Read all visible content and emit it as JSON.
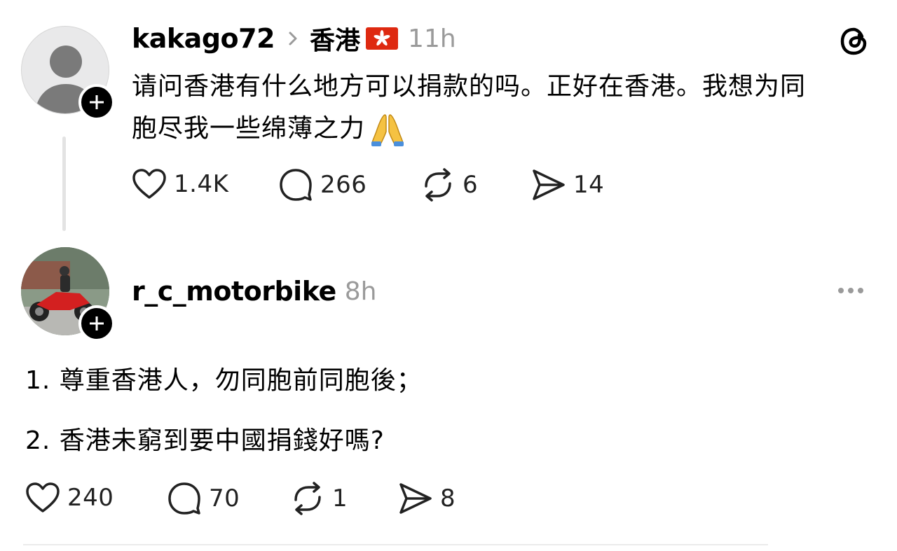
{
  "post": {
    "username": "kakago72",
    "location": "香港",
    "flag_emoji": "🇭🇰",
    "time": "11h",
    "text_line1": "请问香港有什么地方可以捐款的吗。正好在香港。我想为同",
    "text_line2": "胞尽我一些绵薄之力",
    "emoji": "🙏",
    "likes": "1.4K",
    "replies": "266",
    "reposts": "6",
    "shares": "14"
  },
  "reply": {
    "username": "r_c_motorbike",
    "time": "8h",
    "line1": "1. 尊重香港人，勿同胞前同胞後；",
    "line2": "2. 香港未窮到要中國捐錢好嗎?",
    "likes": "240",
    "replies": "70",
    "reposts": "1",
    "shares": "8"
  },
  "icons": {
    "app": "threads-logo-icon",
    "more": "more-options-icon",
    "like": "heart-icon",
    "reply": "comment-bubble-icon",
    "repost": "repost-icon",
    "share": "send-icon",
    "follow": "plus-icon"
  },
  "colors": {
    "text": "#000000",
    "muted": "#9a9a9a",
    "thread_line": "#e3e3e3",
    "flag": "#de2910"
  }
}
